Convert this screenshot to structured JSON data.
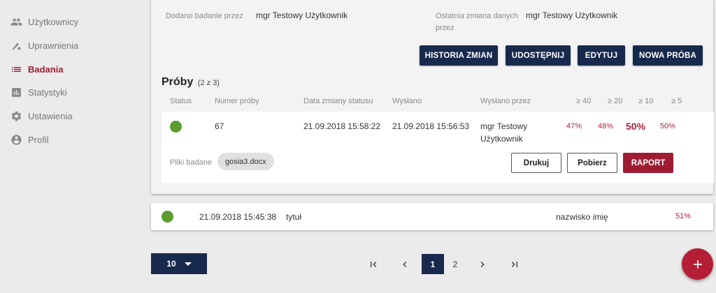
{
  "sidebar": {
    "items": [
      {
        "label": "Użytkownicy",
        "icon": "users-icon"
      },
      {
        "label": "Uprawnienia",
        "icon": "permissions-icon"
      },
      {
        "label": "Badania",
        "icon": "list-icon"
      },
      {
        "label": "Statystyki",
        "icon": "bar-chart-icon"
      },
      {
        "label": "Ustawienia",
        "icon": "gear-icon"
      },
      {
        "label": "Profil",
        "icon": "profile-icon"
      }
    ]
  },
  "detail": {
    "added_by_label": "Dodano badanie przez",
    "added_by_value": "mgr Testowy Użytkownik",
    "changed_by_label_1": "Ostatnia zmiana danych",
    "changed_by_label_2": "przez",
    "changed_by_value": "mgr Testowy Użytkownik",
    "actions": {
      "history": "HISTORIA ZMIAN",
      "share": "UDOSTĘPNIJ",
      "edit": "EDYTUJ",
      "new_attempt": "NOWA PRÓBA"
    },
    "attempts_title": "Próby",
    "attempts_count": "(2 z 3)",
    "columns": {
      "status": "Status",
      "number": "Numer próby",
      "status_date": "Data zmiany statusu",
      "sent": "Wysłano",
      "sent_by": "Wysłano przez",
      "t40": "≥ 40",
      "t20": "≥ 20",
      "t10": "≥ 10",
      "t5": "≥ 5"
    },
    "attempt": {
      "number": "67",
      "status_date": "21.09.2018 15:58:22",
      "sent": "21.09.2018 15:56:53",
      "sent_by_1": "mgr Testowy",
      "sent_by_2": "Użytkownik",
      "p40": "47%",
      "p20": "48%",
      "p10": "50%",
      "p5": "50%",
      "files_label": "Pliki badane",
      "file": "gosia3.docx",
      "print": "Drukuj",
      "download": "Pobierz",
      "report": "RAPORT"
    }
  },
  "list_row": {
    "date": "21.09.2018 15:45:38",
    "title": "tytuł",
    "name": "nazwisko imię",
    "percent": "51%"
  },
  "footer": {
    "page_size": "10",
    "pages": [
      "1",
      "2"
    ],
    "current_page": "1"
  },
  "colors": {
    "accent": "#a01c33",
    "navy": "#17294d",
    "status_ok": "#5c9c2f"
  }
}
